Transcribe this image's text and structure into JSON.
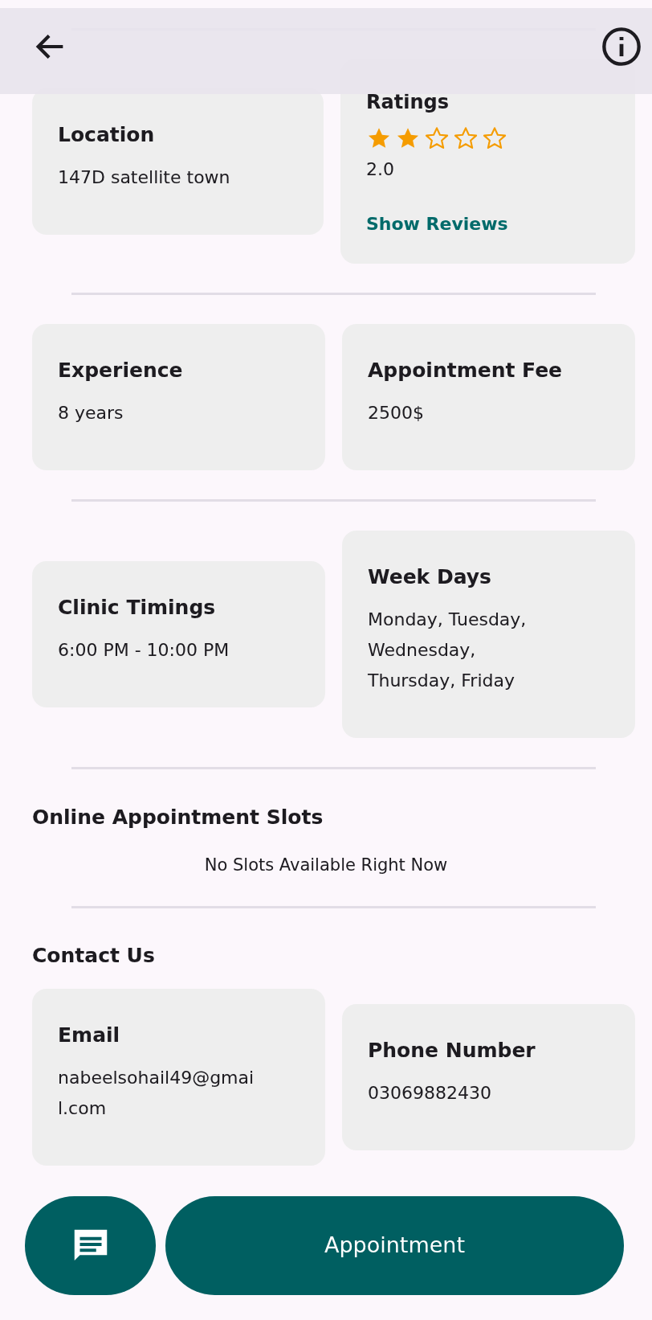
{
  "rows": [
    [
      {
        "kind": "info",
        "title": "Location",
        "lines": [
          "147D satellite town"
        ]
      },
      {
        "kind": "rating",
        "title": "Ratings",
        "stars": 2,
        "reading": "2.0",
        "link": "Show Reviews"
      }
    ],
    [
      {
        "kind": "info",
        "title": "Experience",
        "lines": [
          "8 years"
        ]
      },
      {
        "kind": "info",
        "title": "Appointment Fee",
        "lines": [
          "2500$"
        ]
      }
    ],
    [
      {
        "kind": "info",
        "title": "Clinic Timings",
        "lines": [
          "6:00 PM - 10:00 PM"
        ]
      },
      {
        "kind": "info",
        "title": "Week Days",
        "lines": [
          "Monday, Tuesday,",
          "Wednesday,",
          "Thursday, Friday"
        ]
      }
    ]
  ],
  "slots": {
    "heading": "Online Appointment Slots",
    "message": "No Slots Available Right Now"
  },
  "contact": {
    "heading": "Contact Us",
    "cards": [
      {
        "kind": "info",
        "title": "Email",
        "lines": [
          "nabeelsohail49@gmai",
          "l.com"
        ]
      },
      {
        "kind": "info",
        "title": "Phone Number",
        "lines": [
          "03069882430"
        ]
      }
    ]
  },
  "actions": {
    "appointment": "Appointment"
  }
}
